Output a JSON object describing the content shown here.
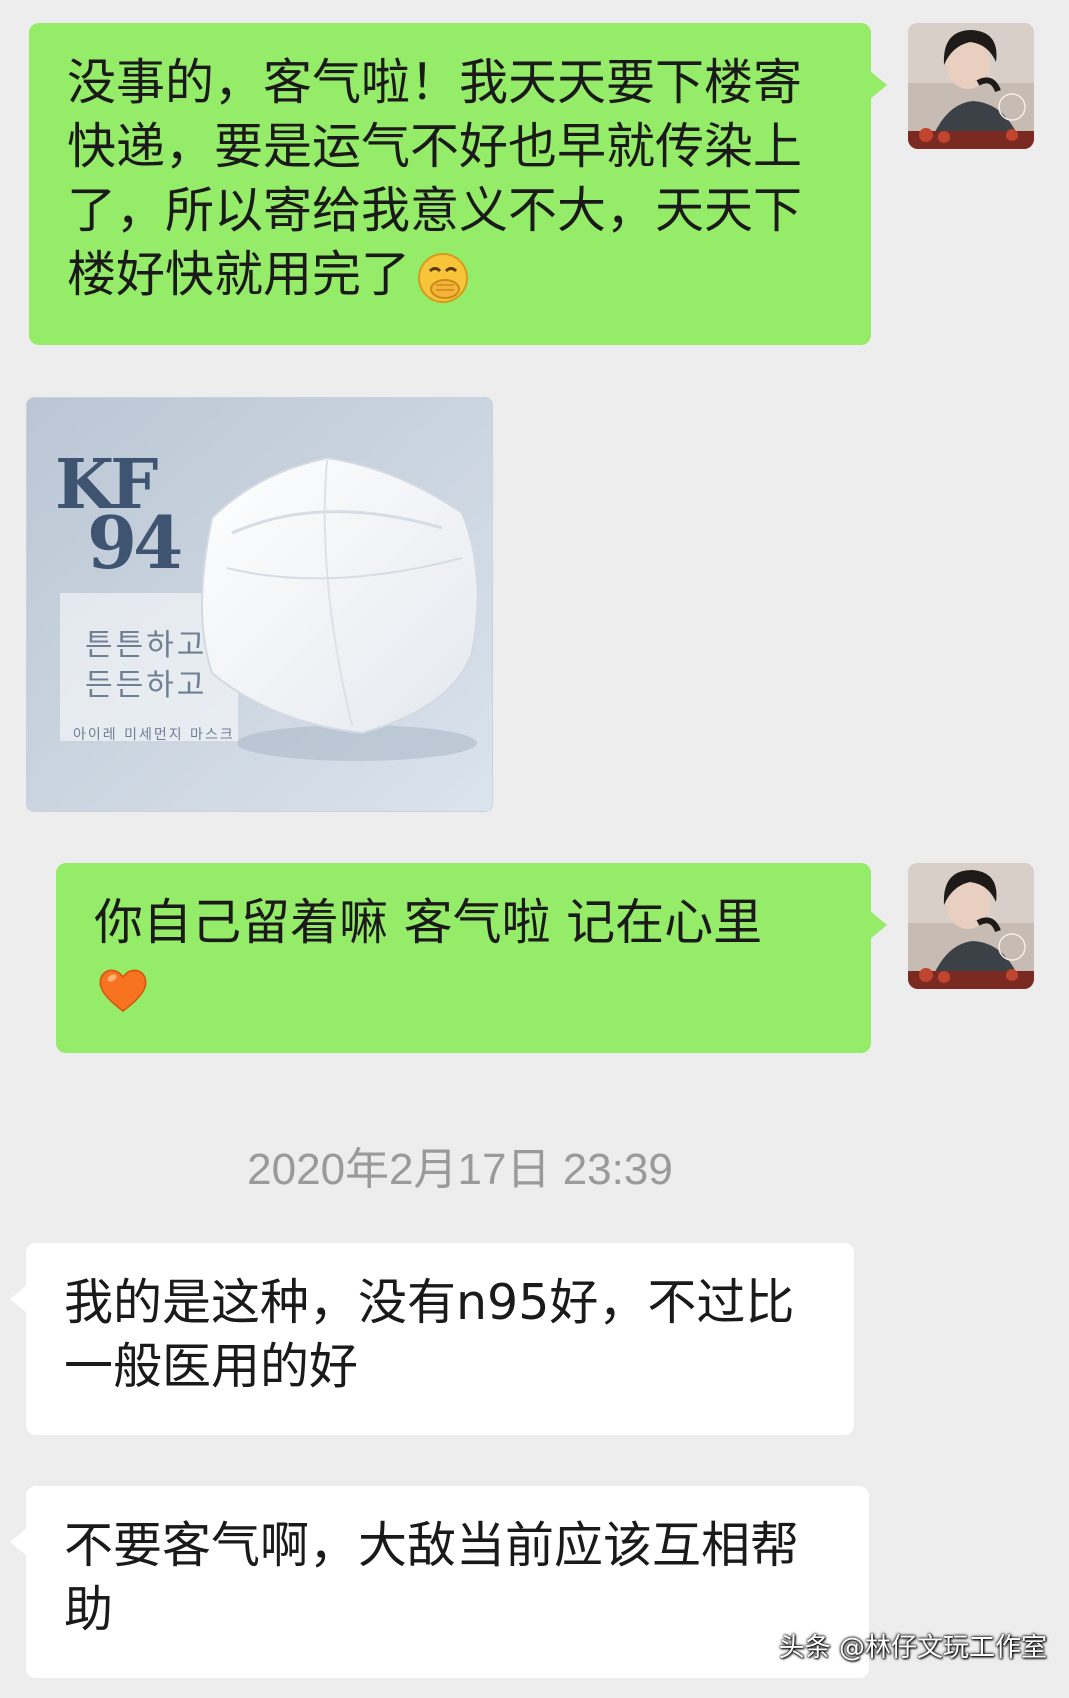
{
  "messages": [
    {
      "sender": "self",
      "text": "没事的，客气啦！我天天要下楼寄快递，要是运气不好也早就传染上了，所以寄给我意义不大，天天下楼好快就用完了",
      "emoji": "face-with-hand-over-mouth-emoji"
    },
    {
      "sender": "other",
      "type": "image",
      "brand_text": [
        "KF",
        "94"
      ],
      "korean_lines": [
        "튼튼하고",
        "든든하고"
      ],
      "korean_small": "아이레 미세먼지 마스크"
    },
    {
      "sender": "self",
      "text": "你自己留着嘛 客气啦 记在心里",
      "emoji": "orange-heart-emoji"
    },
    {
      "sender": "other",
      "text": "我的是这种，没有n95好，不过比一般医用的好"
    },
    {
      "sender": "other",
      "text": "不要客气啊，大敌当前应该互相帮助"
    }
  ],
  "timestamp": "2020年2月17日 23:39",
  "watermark": "头条 @林仔文玩工作室",
  "colors": {
    "background": "#ededed",
    "self_bubble": "#95ec69",
    "other_bubble": "#ffffff",
    "timestamp": "#9a9a9a"
  }
}
